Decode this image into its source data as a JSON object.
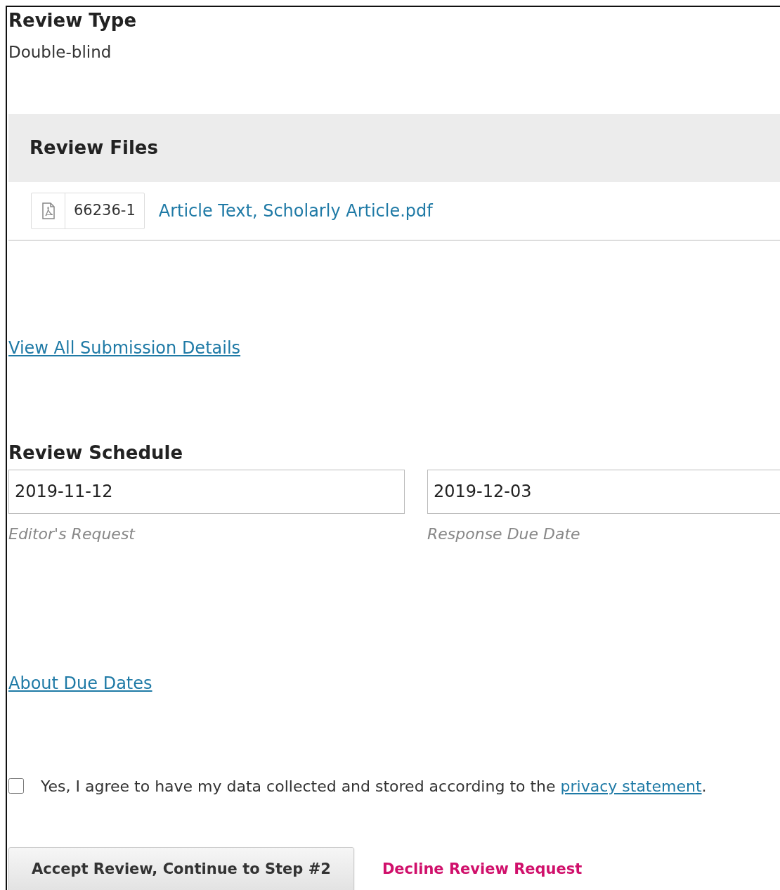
{
  "review_type": {
    "heading": "Review Type",
    "value": "Double-blind"
  },
  "review_files": {
    "heading": "Review Files",
    "files": [
      {
        "id": "66236-1",
        "name": "Article Text, Scholarly Article.pdf"
      }
    ]
  },
  "submission_link": "View All Submission Details",
  "review_schedule": {
    "heading": "Review Schedule",
    "dates": [
      {
        "value": "2019-11-12",
        "label": "Editor's Request"
      },
      {
        "value": "2019-12-03",
        "label": "Response Due Date"
      }
    ]
  },
  "due_dates_link": "About Due Dates",
  "consent": {
    "checked": false,
    "text": "Yes, I agree to have my data collected and stored according to the ",
    "link": "privacy statement",
    "text_after": "."
  },
  "actions": {
    "accept": "Accept Review, Continue to Step #2",
    "decline": "Decline Review Request"
  }
}
